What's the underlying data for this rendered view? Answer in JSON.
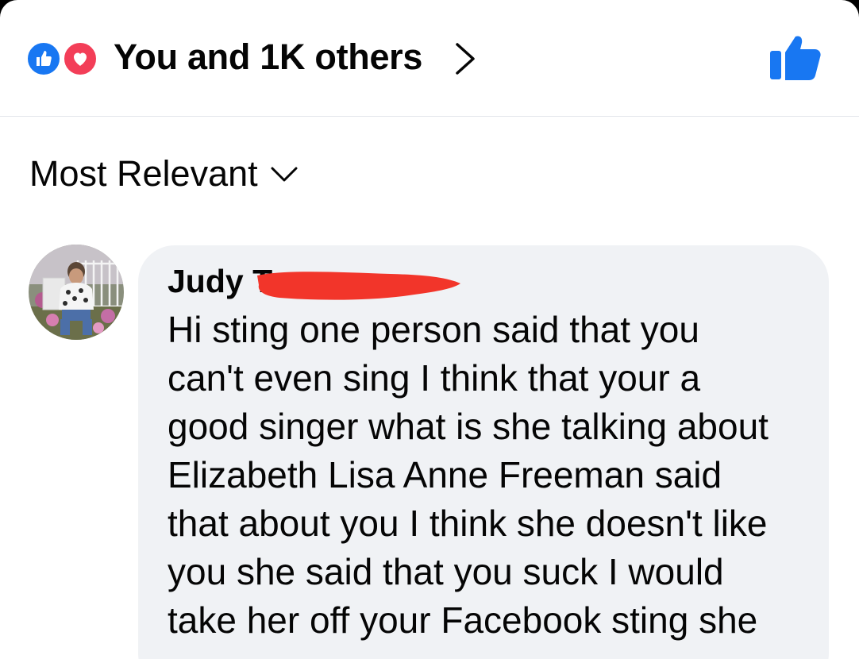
{
  "reactions": {
    "summary": "You and 1K others",
    "icons": [
      "like-icon",
      "love-icon"
    ],
    "colors": {
      "like": "#1877f2",
      "love": "#f33e58"
    }
  },
  "sort": {
    "label": "Most Relevant"
  },
  "comment": {
    "author": "Judy T",
    "text": "Hi sting one person said that you\ncan't even sing I think that your a\ngood singer what is she talking about\nElizabeth Lisa Anne Freeman said\nthat about you I think she doesn't like\nyou she said that you suck I would\ntake her off your Facebook sting she"
  }
}
